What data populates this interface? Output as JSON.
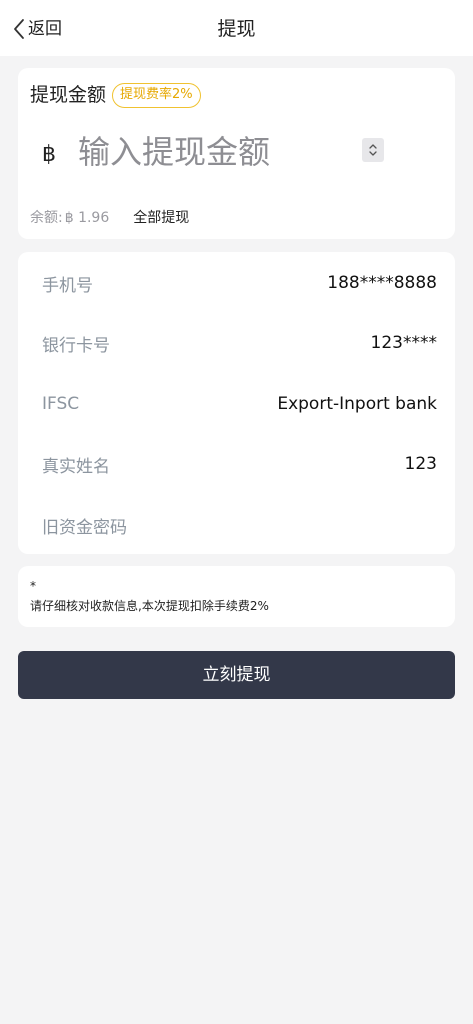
{
  "nav": {
    "back_label": "返回",
    "title": "提现"
  },
  "amount_card": {
    "title": "提现金额",
    "fee_badge": "提现费率2%",
    "currency_symbol": "฿",
    "amount_placeholder": "输入提现金额",
    "balance_label": "余额:",
    "balance_value": "฿ 1.96",
    "withdraw_all": "全部提现"
  },
  "info": {
    "phone": {
      "label": "手机号",
      "value": "188****8888"
    },
    "bank_card": {
      "label": "银行卡号",
      "value": "123****"
    },
    "ifsc": {
      "label": "IFSC",
      "value": "Export-Inport bank"
    },
    "real_name": {
      "label": "真实姓名",
      "value": "123"
    },
    "fund_password": {
      "label": "旧资金密码",
      "value": ""
    }
  },
  "notice": {
    "star": "*",
    "text": "请仔细核对收款信息,本次提现扣除手续费2%"
  },
  "submit_label": "立刻提现",
  "colors": {
    "accent_badge": "#f0c230",
    "button_bg": "#333849",
    "page_bg": "#f4f4f5"
  }
}
